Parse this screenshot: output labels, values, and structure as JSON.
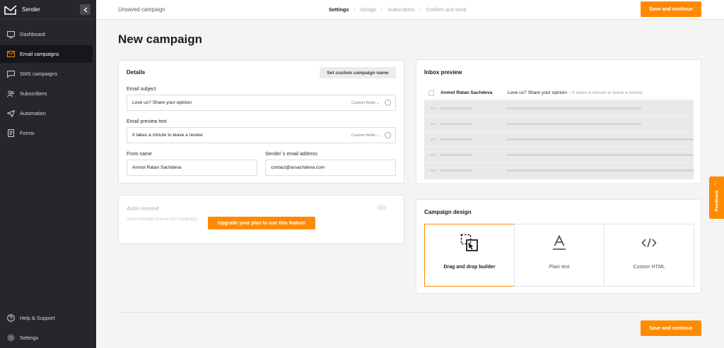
{
  "sidebar": {
    "logo_text": "Sender",
    "items": [
      {
        "label": "Dashboard",
        "icon": "dashboard-icon"
      },
      {
        "label": "Email campaigns",
        "icon": "envelope-icon",
        "active": true
      },
      {
        "label": "SMS campaigns",
        "icon": "chat-icon"
      },
      {
        "label": "Subscribers",
        "icon": "users-icon"
      },
      {
        "label": "Automation",
        "icon": "paper-plane-icon"
      },
      {
        "label": "Forms",
        "icon": "form-icon"
      }
    ],
    "bottom_items": [
      {
        "label": "Help & Support",
        "icon": "help-icon"
      },
      {
        "label": "Settings",
        "icon": "gear-icon"
      }
    ]
  },
  "topbar": {
    "status": "Unsaved campaign",
    "steps": [
      "Settings",
      "Design",
      "Subscribers",
      "Confirm and send"
    ],
    "active_step": "Settings",
    "save_label": "Save and continue"
  },
  "page_title": "New campaign",
  "details": {
    "title": "Details",
    "custom_name_button": "Set custom campaign name",
    "subject_label": "Email subject",
    "subject_value": "Love us? Share your opinion",
    "preview_label": "Email preview text",
    "preview_value": "It takes a minute to leave a review",
    "custom_fields": "Custom fields",
    "from_name_label": "From name",
    "from_name_value": "Anmol Ratan Sachdeva",
    "sender_email_label": "Sender`s email address",
    "sender_email_value": "contact@arsachdeva.com"
  },
  "autoresend": {
    "title": "Auto resend",
    "description": "Automatically resend this campaign",
    "upgrade_label": "Upgrade your plan to use this feature"
  },
  "inbox_preview": {
    "title": "Inbox preview",
    "sender": "Anmol Ratan Sachdeva",
    "subject": "Love us? Share your opinion",
    "preview": "- It takes a minute to leave a review"
  },
  "campaign_design": {
    "title": "Campaign design",
    "options": [
      {
        "label": "Drag and drop builder",
        "icon": "drag-drop-icon",
        "selected": true
      },
      {
        "label": "Plain text",
        "icon": "text-a-icon"
      },
      {
        "label": "Custom HTML",
        "icon": "code-icon"
      }
    ]
  },
  "footer": {
    "save_label": "Save and continue"
  },
  "feedback": {
    "label": "Feedback"
  },
  "colors": {
    "accent": "#ff8a00",
    "sidebar": "#26272c"
  }
}
